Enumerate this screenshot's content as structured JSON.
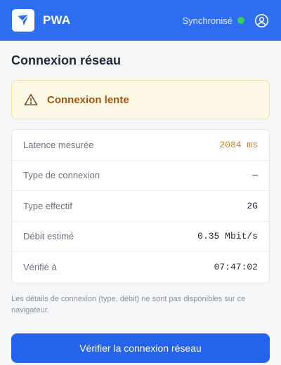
{
  "header": {
    "app_name": "PWA",
    "sync_status": "Synchronisé",
    "colors": {
      "bar": "#2f6df0",
      "sync_dot": "#34d058"
    },
    "icons": {
      "logo": "send-arrow-icon",
      "account": "user-circle-icon"
    }
  },
  "page": {
    "title": "Connexion réseau"
  },
  "alert": {
    "icon": "warning-triangle-icon",
    "text": "Connexion lente",
    "colors": {
      "background": "#fef9e7",
      "text": "#a1550e"
    }
  },
  "details": [
    {
      "label": "Latence mesurée",
      "value": "2084 ms",
      "status": "warning"
    },
    {
      "label": "Type de connexion",
      "value": "—"
    },
    {
      "label": "Type effectif",
      "value": "2G"
    },
    {
      "label": "Débit estimé",
      "value": "0.35 Mbit/s"
    },
    {
      "label": "Vérifié à",
      "value": "07:47:02"
    }
  ],
  "note": "Les détails de connexion (type, débit) ne sont pas disponibles sur ce navigateur.",
  "actions": {
    "verify_label": "Vérifier la connexion réseau",
    "color": "#2563eb"
  }
}
